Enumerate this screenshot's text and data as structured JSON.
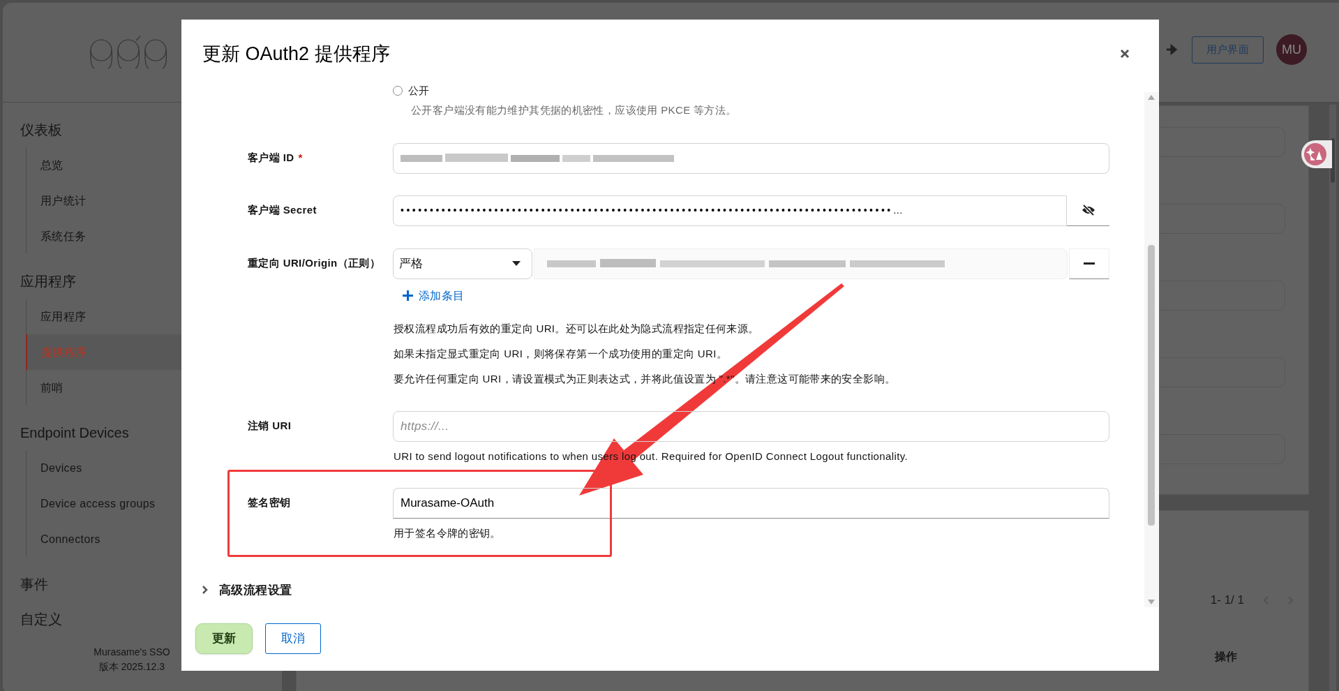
{
  "header": {
    "ui_button": "用户界面",
    "avatar": "MU"
  },
  "sidebar": {
    "sections": [
      {
        "label": "仪表板",
        "children": [
          {
            "label": "总览",
            "selected": false
          },
          {
            "label": "用户统计",
            "selected": false
          },
          {
            "label": "系统任务",
            "selected": false
          }
        ]
      },
      {
        "label": "应用程序",
        "children": [
          {
            "label": "应用程序",
            "selected": false
          },
          {
            "label": "提供程序",
            "selected": true
          },
          {
            "label": "前哨",
            "selected": false
          }
        ]
      },
      {
        "label": "Endpoint Devices",
        "children": [
          {
            "label": "Devices",
            "selected": false
          },
          {
            "label": "Device access groups",
            "selected": false
          },
          {
            "label": "Connectors",
            "selected": false
          }
        ]
      },
      {
        "label": "事件"
      },
      {
        "label": "自定义"
      }
    ],
    "footer": [
      "Murasame's SSO",
      "版本 2025.12.3"
    ]
  },
  "background": {
    "pagination": "1- 1/ 1",
    "column_header": "操作"
  },
  "modal": {
    "title": "更新 OAuth2 提供程序",
    "radio": {
      "label": "公开",
      "checked": false,
      "help": "公开客户端没有能力维护其凭据的机密性，应该使用 PKCE 等方法。"
    },
    "fields": [
      {
        "kind": "blurred",
        "label": "客户端 ID",
        "required_mark": "*",
        "highlighted": false
      },
      {
        "kind": "password",
        "label": "客户端 Secret",
        "highlighted": false,
        "value": "••••••••••••••••••••••••••••••••••••••••••••••••••••••••••••••••••••••••••••••••••••…"
      },
      {
        "kind": "redirect",
        "label": "重定向 URI/Origin（正则）",
        "highlighted": false,
        "mode": "严格",
        "add": "添加条目",
        "help": [
          "授权流程成功后有效的重定向 URI。还可以在此处为隐式流程指定任何来源。",
          "如果未指定显式重定向 URI，则将保存第一个成功使用的重定向 URI。",
          "要允许任何重定向 URI，请设置模式为正则表达式，并将此值设置为 \".*\"。请注意这可能带来的安全影响。"
        ]
      },
      {
        "kind": "text",
        "label": "注销 URI",
        "highlighted": false,
        "placeholder": "https://...",
        "help": [
          "URI to send logout notifications to when users log out. Required for OpenID Connect Logout functionality."
        ]
      },
      {
        "kind": "text",
        "label": "签名密钥",
        "highlighted": true,
        "value": "Murasame-OAuth",
        "help": [
          "用于签名令牌的密钥。"
        ]
      }
    ],
    "advanced": {
      "label": "高级流程设置",
      "expanded": false
    },
    "buttons": [
      {
        "label": "更新",
        "kind": "primary"
      },
      {
        "label": "取消",
        "kind": "secondary"
      }
    ]
  }
}
